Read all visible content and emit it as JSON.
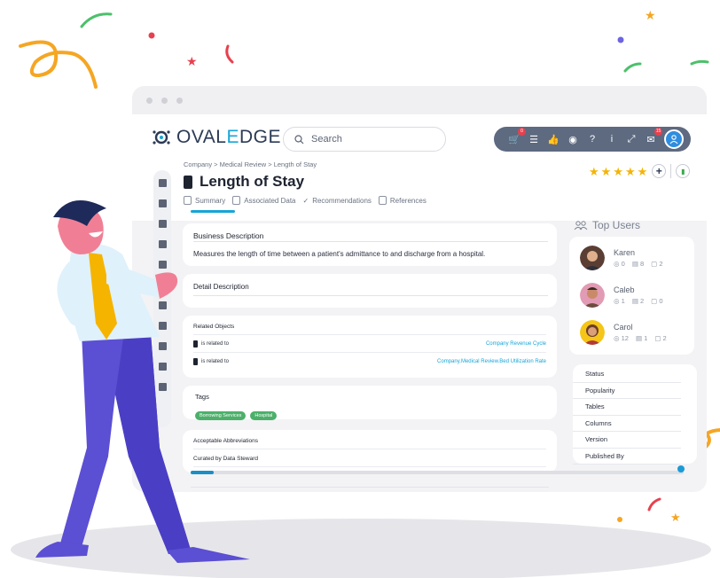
{
  "app": {
    "logo_text_prefix": "OVAL",
    "logo_text_accent": "E",
    "logo_text_suffix": "DGE"
  },
  "search": {
    "placeholder": "Search"
  },
  "toolbar": {
    "icons": [
      "cart-icon",
      "checklist-icon",
      "thumbs-up-icon",
      "chrome-icon",
      "help-icon",
      "info-icon",
      "expand-icon",
      "mail-icon",
      "user-icon"
    ],
    "cart_badge": "0",
    "mail_badge": "15"
  },
  "breadcrumb": "Company > Medical Review > Length of Stay",
  "page": {
    "title": "Length of Stay",
    "rating_stars": 5
  },
  "tabs": [
    "Summary",
    "Associated Data",
    "Recommendations",
    "References"
  ],
  "business_description": {
    "title": "Business Description",
    "text": "Measures the length of time between a patient's admittance to and discharge from a hospital."
  },
  "detail_description": {
    "title": "Detail Description"
  },
  "related_objects": {
    "title": "Related Objects",
    "rows": [
      {
        "relation": "is related to",
        "target": "Company Revenue Cycle"
      },
      {
        "relation": "is related to",
        "target": "Company.Medical Review.Bed Utilization Rate"
      }
    ]
  },
  "tags": {
    "title": "Tags",
    "items": [
      "Borrowing Services",
      "Hospital"
    ]
  },
  "abbreviations": {
    "title": "Acceptable Abbreviations",
    "curated": "Curated by Data Steward"
  },
  "top_users": {
    "title": "Top Users",
    "users": [
      {
        "name": "Karen",
        "views": "0",
        "tables": "8",
        "comments": "2"
      },
      {
        "name": "Caleb",
        "views": "1",
        "tables": "2",
        "comments": "0"
      },
      {
        "name": "Carol",
        "views": "12",
        "tables": "1",
        "comments": "2"
      }
    ]
  },
  "properties": [
    "Status",
    "Popularity",
    "Tables",
    "Columns",
    "Version",
    "Published By"
  ],
  "colors": {
    "accent": "#16a5d8",
    "toolbar": "#5d6a80",
    "tag": "#4cb06a",
    "star": "#f5b400"
  }
}
